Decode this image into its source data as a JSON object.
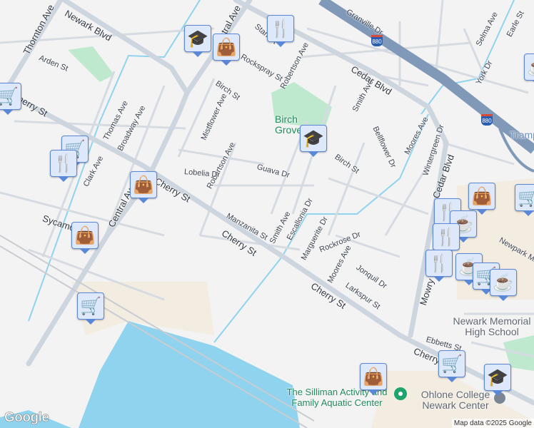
{
  "streets": {
    "newark_blvd": "Newark Blvd",
    "thornton_ave": "Thornton Ave",
    "arden_st": "Arden St",
    "cherry_st_1": "Cherry St",
    "cherry_st_2": "Cherry St",
    "cherry_st_3": "Cherry St",
    "cherry_st_4": "Cherry St",
    "cherry_st_5": "Cherry",
    "thomas_ave": "Thomas Ave",
    "broadway_ave": "Broadway Ave",
    "clark_ave": "Clark Ave",
    "central_ave_1": "Central Ave",
    "central_ave_2": "Central Ave",
    "sycamore": "Sycamo",
    "mistflower_ave": "Mistflower Ave",
    "birch_st_1": "Birch St",
    "birch_st_2": "Birch St",
    "rockspray_st": "Rockspray St",
    "starr_st": "Starr St",
    "robertson_ave_1": "Robertson Ave",
    "robertson_ave_2": "Robertson Ave",
    "lobelia_dr": "Lobelia Dr",
    "guava_dr": "Guava Dr",
    "manzanita_st": "Manzanita St",
    "smith_ave_1": "Smith Ave",
    "smith_ave_2": "Smith Ave",
    "escallonia_dr": "Escallonia Dr",
    "marguerite_dr": "Marguerite Dr",
    "rockrose_dr": "Rockrose Dr",
    "moores_ave_1": "Moores Ave",
    "moores_ave_2": "Moores Ave",
    "jonquil_dr": "Jonquil Dr",
    "larkspur_st": "Larkspur St",
    "bellflower_dr": "Bellflower Dr",
    "wintergreen_dr": "Wintergreen Dr",
    "cedar_blvd_1": "Cedar Blvd",
    "cedar_blvd_2": "Cedar Blvd",
    "granville_dr": "Granville Dr",
    "selma_ave": "Selma Ave",
    "york_dr": "York Dr",
    "earle_st": "Earle St",
    "ebbetts": "Ebbetts St",
    "mowry": "Mowry",
    "newpark_mall": "Newpark Mall",
    "tramp": "Tramp"
  },
  "highway": {
    "shield_1": "880",
    "shield_2": "880"
  },
  "places": {
    "birch_grove": "Birch Grove",
    "newark_memorial": "Newark Memorial High School",
    "silliman": "The Silliman Activity and Family Aquatic Center",
    "ohlone": "Ohlone College Newark Center"
  },
  "colors": {
    "water": "#8fd3ee",
    "park": "#bfe9cf",
    "highway": "#8199b8",
    "marker": "#0c3f66"
  },
  "attribution": "Map data ©2025 Google",
  "logo": "Google"
}
